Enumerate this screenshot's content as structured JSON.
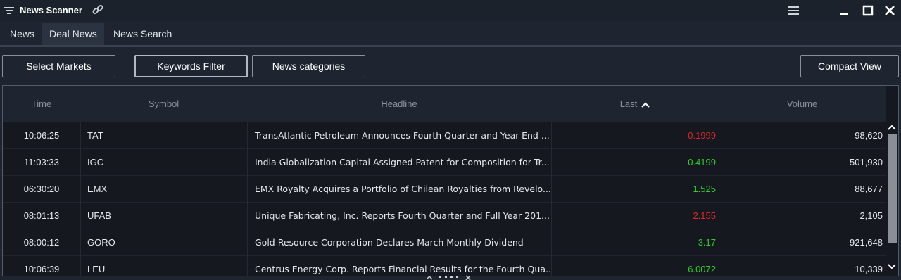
{
  "window": {
    "title": "News Scanner"
  },
  "tabs": [
    {
      "label": "News",
      "active": false
    },
    {
      "label": "Deal News",
      "active": true
    },
    {
      "label": "News Search",
      "active": false
    }
  ],
  "toolbar": {
    "select_markets": "Select Markets",
    "keywords_filter": "Keywords Filter",
    "news_categories": "News categories",
    "compact_view": "Compact View"
  },
  "table": {
    "columns": [
      "Time",
      "Symbol",
      "Headline",
      "Last",
      "Volume"
    ],
    "sorted_column": "Last",
    "sort_direction": "ascending",
    "rows": [
      {
        "time": "10:06:25",
        "symbol": "TAT",
        "headline": "TransAtlantic Petroleum Announces Fourth Quarter and Year-End ...",
        "last": "0.1999",
        "last_dir": "down",
        "volume": "98,620"
      },
      {
        "time": "11:03:33",
        "symbol": "IGC",
        "headline": "India Globalization Capital Assigned Patent for Composition for Tr...",
        "last": "0.4199",
        "last_dir": "up",
        "volume": "501,930"
      },
      {
        "time": "06:30:20",
        "symbol": "EMX",
        "headline": "EMX Royalty Acquires a Portfolio of Chilean Royalties from Revelo...",
        "last": "1.525",
        "last_dir": "up",
        "volume": "88,677"
      },
      {
        "time": "08:01:13",
        "symbol": "UFAB",
        "headline": "Unique Fabricating, Inc. Reports Fourth Quarter and Full Year 201...",
        "last": "2.155",
        "last_dir": "down",
        "volume": "2,105"
      },
      {
        "time": "08:00:12",
        "symbol": "GORO",
        "headline": "Gold Resource Corporation Declares March Monthly Dividend",
        "last": "3.17",
        "last_dir": "up",
        "volume": "921,648"
      },
      {
        "time": "10:06:39",
        "symbol": "LEU",
        "headline": "Centrus Energy Corp. Reports Financial Results for the Fourth Qua...",
        "last": "6.0072",
        "last_dir": "up",
        "volume": "10,339"
      }
    ]
  },
  "colors": {
    "up": "#2ecc2e",
    "down": "#e0262a",
    "background": "#1e2530",
    "grid_background": "#15191f"
  },
  "icons": {
    "menu": "filter-lines-icon",
    "link": "link-icon",
    "hamburger": "hamburger-icon",
    "minimize": "minimize-icon",
    "maximize": "maximize-icon",
    "close": "close-icon",
    "sort": "chevron-up-icon",
    "scroll_up": "chevron-up-icon",
    "scroll_down": "chevron-down-icon",
    "drag": "drag-handle-icon"
  }
}
